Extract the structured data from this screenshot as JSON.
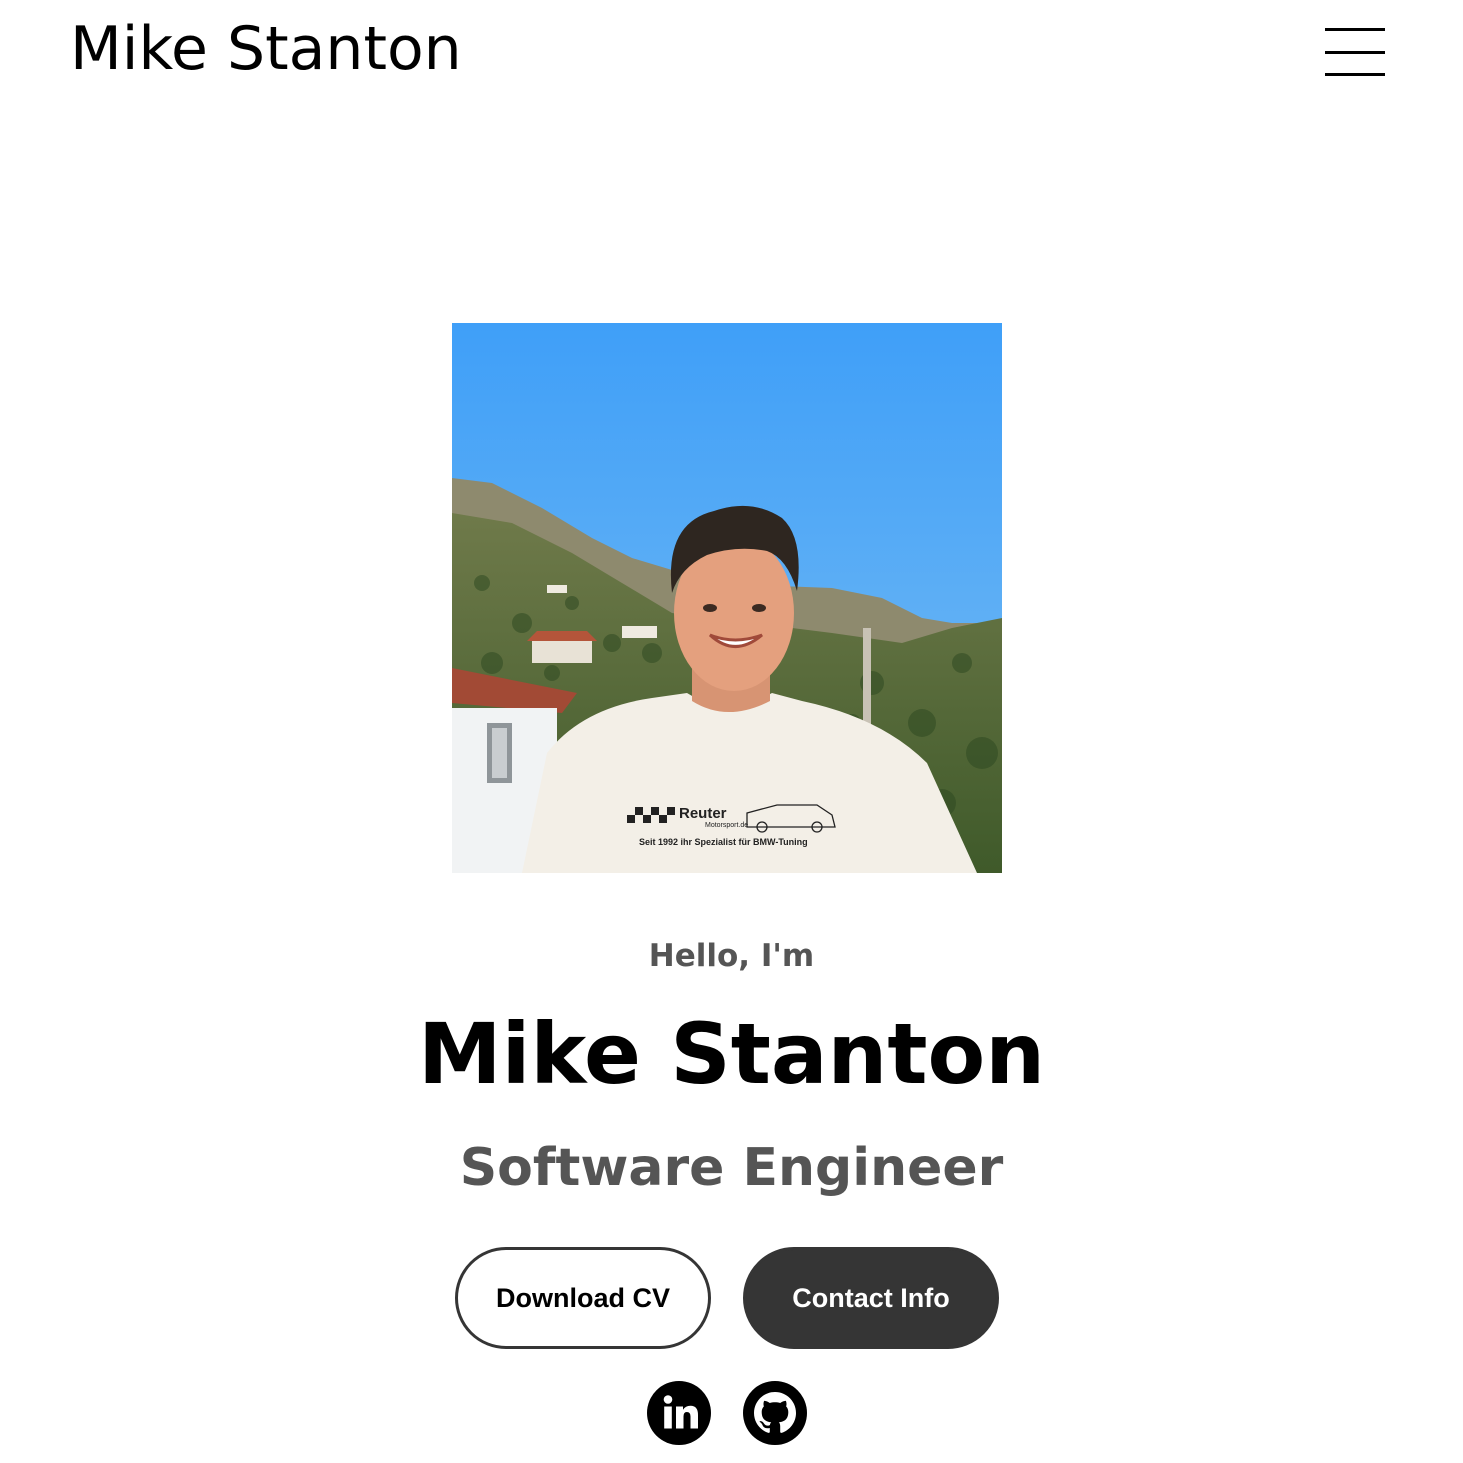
{
  "nav": {
    "logo": "Mike Stanton"
  },
  "profile": {
    "shirt_brand": "Reuter",
    "shirt_site": "Motorsport.de",
    "shirt_tagline": "Seit 1992 ihr Spezialist für BMW-Tuning"
  },
  "hero": {
    "greeting": "Hello, I'm",
    "name": "Mike Stanton",
    "role": "Software Engineer",
    "download_cv_label": "Download CV",
    "contact_info_label": "Contact Info"
  },
  "socials": [
    {
      "icon": "linkedin-icon"
    },
    {
      "icon": "github-icon"
    }
  ],
  "colors": {
    "text": "#000000",
    "muted": "#555555",
    "button_dark": "#353535",
    "sky_top": "#3f9ff8",
    "sky_bottom": "#6fb8f4"
  }
}
